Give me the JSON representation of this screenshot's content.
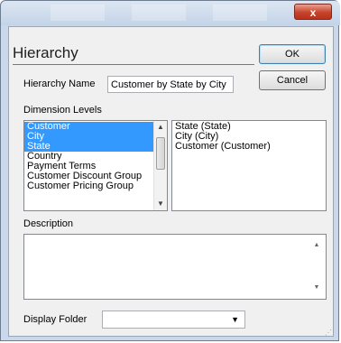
{
  "window": {
    "close_glyph": "x",
    "dialog_title": "Hierarchy"
  },
  "buttons": {
    "ok": "OK",
    "cancel": "Cancel"
  },
  "hierarchy_name": {
    "label": "Hierarchy Name",
    "value": "Customer by State by City"
  },
  "dimension_levels": {
    "label": "Dimension Levels",
    "available": [
      {
        "label": "Customer",
        "selected": true
      },
      {
        "label": "City",
        "selected": true
      },
      {
        "label": "State",
        "selected": true
      },
      {
        "label": "Country",
        "selected": false
      },
      {
        "label": "Payment Terms",
        "selected": false
      },
      {
        "label": "Customer Discount Group",
        "selected": false
      },
      {
        "label": "Customer Pricing Group",
        "selected": false
      }
    ],
    "chosen": [
      "State (State)",
      "City (City)",
      "Customer (Customer)"
    ]
  },
  "description": {
    "label": "Description",
    "value": ""
  },
  "display_folder": {
    "label": "Display Folder",
    "value": ""
  },
  "icons": {
    "close": "close-icon",
    "scroll_up": "scroll-up-icon",
    "scroll_down": "scroll-down-icon",
    "dropdown": "chevron-down-icon"
  },
  "colors": {
    "selection": "#3399ff",
    "close_button": "#c8432b",
    "default_button_border": "#3c7fb1"
  }
}
